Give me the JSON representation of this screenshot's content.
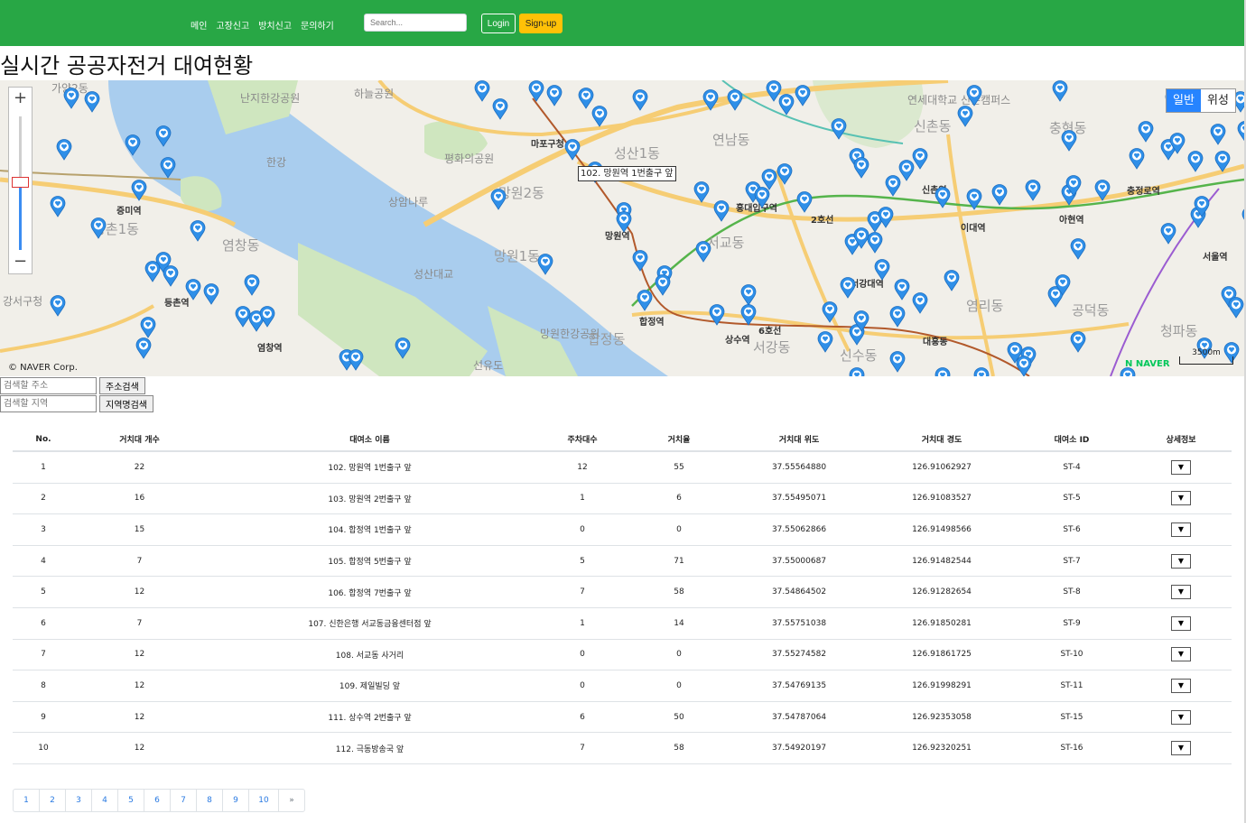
{
  "nav": {
    "links": [
      "메인",
      "고장신고",
      "방치신고",
      "문의하기"
    ],
    "search_placeholder": "Search...",
    "login_label": "Login",
    "signup_label": "Sign-up"
  },
  "page_title": "실시간 공공자전거 대여현황",
  "map": {
    "maptype_normal": "일반",
    "maptype_satellite": "위성",
    "zoom_in": "+",
    "zoom_out": "−",
    "infowindow": "102. 망원역 1번출구 앞",
    "copyright": "© NAVER Corp.",
    "naver_logo": "N NAVER",
    "scale_label": "3500m",
    "labels": [
      "가양2동",
      "난지한강공원",
      "하늘공원",
      "연세대학교 신촌캠퍼스",
      "신촌동",
      "충현동",
      "서울역",
      "마포구청",
      "성산1동",
      "연남동",
      "평화의공원",
      "강서구청",
      "한강",
      "망원2동",
      "망원1동",
      "망원역",
      "서교동",
      "신촌역",
      "이대역",
      "아현역",
      "충정로역",
      "증미역",
      "등촌1동",
      "염창동",
      "상암나루",
      "망원한강공원",
      "홍대입구역",
      "서강대역",
      "대흥동",
      "공덕동",
      "등촌역",
      "염창역",
      "성산대교",
      "합정역",
      "합정동",
      "상수역",
      "서강동",
      "신수동",
      "염리동",
      "청파동",
      "선유도",
      "2호선",
      "6호선"
    ],
    "pin_color": "#2f8fe8",
    "water_color": "#a9cdee",
    "park_color": "#cfe6bf"
  },
  "forms": {
    "address_placeholder": "검색할 주소",
    "address_button": "주소검색",
    "region_placeholder": "검색할 지역",
    "region_button": "지역명검색"
  },
  "table": {
    "headers": [
      "No.",
      "거치대 개수",
      "대여소 이름",
      "주차대수",
      "거치율",
      "거치대 위도",
      "거치대 경도",
      "대여소 ID",
      "상세정보"
    ],
    "rows": [
      [
        "1",
        "22",
        "102. 망원역 1번출구 앞",
        "12",
        "55",
        "37.55564880",
        "126.91062927",
        "ST-4"
      ],
      [
        "2",
        "16",
        "103. 망원역 2번출구 앞",
        "1",
        "6",
        "37.55495071",
        "126.91083527",
        "ST-5"
      ],
      [
        "3",
        "15",
        "104. 합정역 1번출구 앞",
        "0",
        "0",
        "37.55062866",
        "126.91498566",
        "ST-6"
      ],
      [
        "4",
        "7",
        "105. 합정역 5번출구 앞",
        "5",
        "71",
        "37.55000687",
        "126.91482544",
        "ST-7"
      ],
      [
        "5",
        "12",
        "106. 합정역 7번출구 앞",
        "7",
        "58",
        "37.54864502",
        "126.91282654",
        "ST-8"
      ],
      [
        "6",
        "7",
        "107. 신한은행 서교동금융센터점 앞",
        "1",
        "14",
        "37.55751038",
        "126.91850281",
        "ST-9"
      ],
      [
        "7",
        "12",
        "108. 서교동 사거리",
        "0",
        "0",
        "37.55274582",
        "126.91861725",
        "ST-10"
      ],
      [
        "8",
        "12",
        "109. 제일빌딩 앞",
        "0",
        "0",
        "37.54769135",
        "126.91998291",
        "ST-11"
      ],
      [
        "9",
        "12",
        "111. 상수역 2번출구 앞",
        "6",
        "50",
        "37.54787064",
        "126.92353058",
        "ST-15"
      ],
      [
        "10",
        "12",
        "112. 극동방송국 앞",
        "7",
        "58",
        "37.54920197",
        "126.92320251",
        "ST-16"
      ]
    ],
    "detail_glyph": "▼"
  },
  "pagination": [
    "1",
    "2",
    "3",
    "4",
    "5",
    "6",
    "7",
    "8",
    "9",
    "10",
    "»"
  ]
}
